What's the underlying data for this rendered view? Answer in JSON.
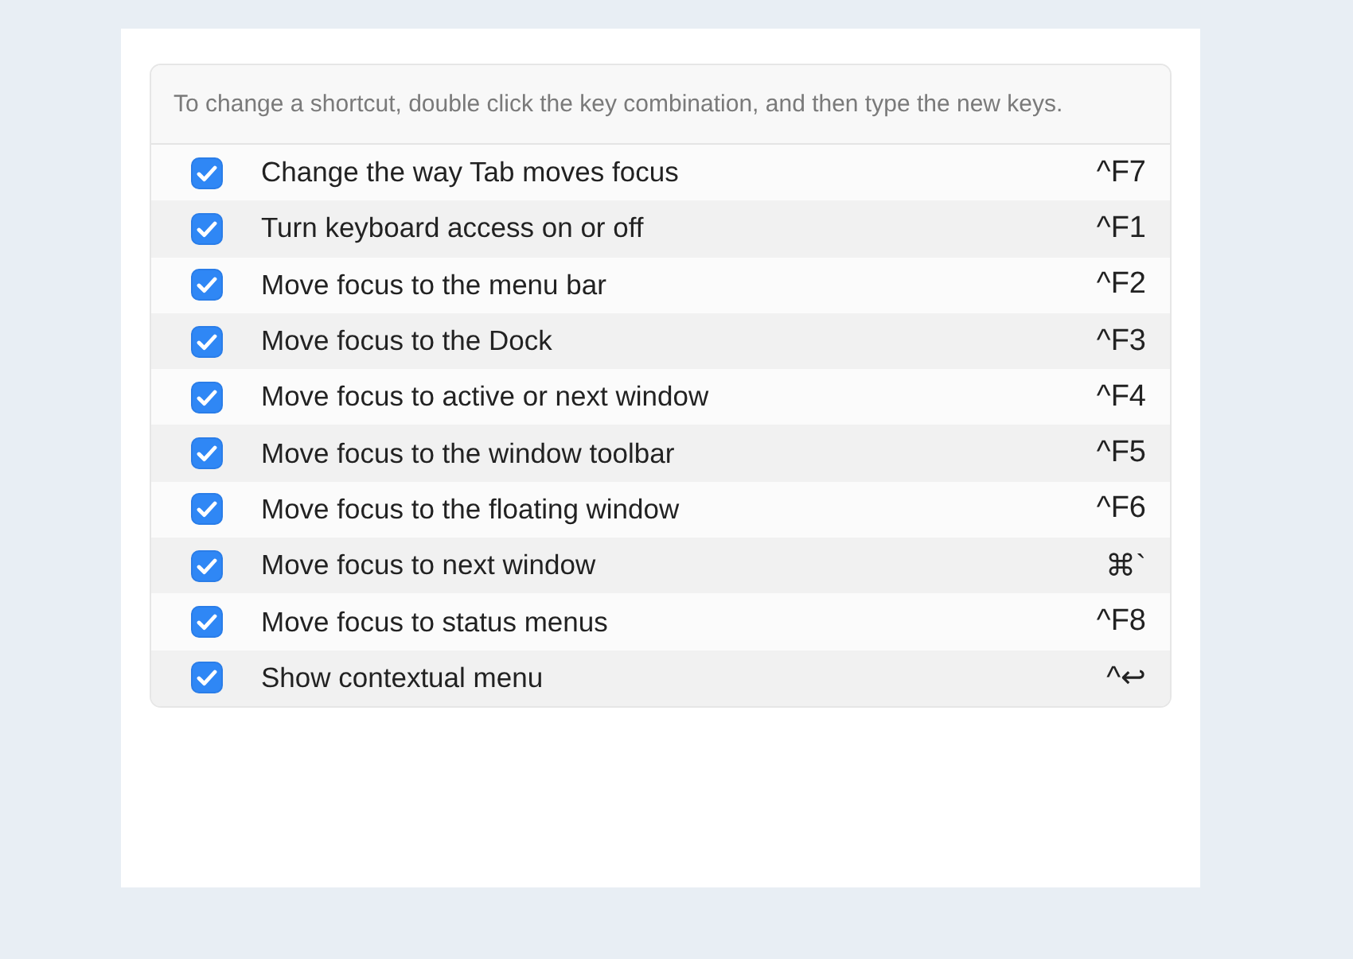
{
  "instructions": "To change a shortcut, double click the key combination, and then type the new keys.",
  "shortcuts": [
    {
      "label": "Change the way Tab moves focus",
      "keys": "^F7",
      "checked": true
    },
    {
      "label": "Turn keyboard access on or off",
      "keys": "^F1",
      "checked": true
    },
    {
      "label": "Move focus to the menu bar",
      "keys": "^F2",
      "checked": true
    },
    {
      "label": "Move focus to the Dock",
      "keys": "^F3",
      "checked": true
    },
    {
      "label": "Move focus to active or next window",
      "keys": "^F4",
      "checked": true
    },
    {
      "label": "Move focus to the window toolbar",
      "keys": "^F5",
      "checked": true
    },
    {
      "label": "Move focus to the floating window",
      "keys": "^F6",
      "checked": true
    },
    {
      "label": "Move focus to next window",
      "keys": "⌘`",
      "checked": true
    },
    {
      "label": "Move focus to status menus",
      "keys": "^F8",
      "checked": true
    },
    {
      "label": "Show contextual menu",
      "keys": "^↩",
      "checked": true
    }
  ]
}
